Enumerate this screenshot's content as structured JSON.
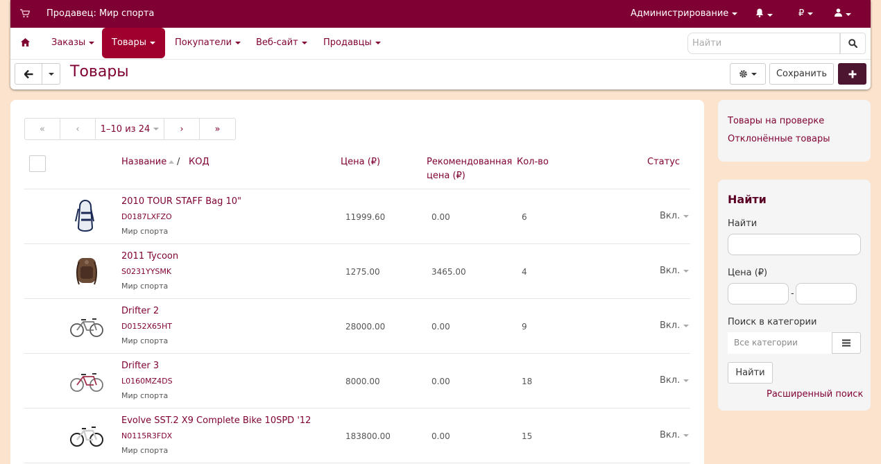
{
  "topbar": {
    "vendor_label": "Продавец: Мир спорта",
    "admin_label": "Администрирование",
    "currency_symbol": "₽"
  },
  "nav": {
    "items": [
      "Заказы",
      "Товары",
      "Покупатели",
      "Веб-сайт",
      "Продавцы"
    ],
    "active": "Товары",
    "search_placeholder": "Найти"
  },
  "toolbar": {
    "title": "Товары",
    "save_label": "Сохранить"
  },
  "pager": {
    "info": "1–10 из 24"
  },
  "table": {
    "headers": {
      "name": "Название",
      "sep": "/",
      "code": "КОД",
      "price": "Цена (₽)",
      "rec_price": "Рекомендованная цена (₽)",
      "qty": "Кол-во",
      "status": "Статус"
    },
    "rows": [
      {
        "name": "2010 TOUR STAFF Bag 10\"",
        "code": "D0187LXFZO",
        "vendor": "Мир спорта",
        "price": "11999.60",
        "rec": "0.00",
        "qty": "6",
        "status": "Вкл."
      },
      {
        "name": "2011 Tycoon",
        "code": "S0231YYSMK",
        "vendor": "Мир спорта",
        "price": "1275.00",
        "rec": "3465.00",
        "qty": "4",
        "status": "Вкл."
      },
      {
        "name": "Drifter 2",
        "code": "D0152X65HT",
        "vendor": "Мир спорта",
        "price": "28000.00",
        "rec": "0.00",
        "qty": "9",
        "status": "Вкл."
      },
      {
        "name": "Drifter 3",
        "code": "L0160MZ4DS",
        "vendor": "Мир спорта",
        "price": "8000.00",
        "rec": "0.00",
        "qty": "18",
        "status": "Вкл."
      },
      {
        "name": "Evolve SST.2 X9 Complete Bike 10SPD '12",
        "code": "N0115R3FDX",
        "vendor": "Мир спорта",
        "price": "183800.00",
        "rec": "0.00",
        "qty": "15",
        "status": "Вкл."
      }
    ]
  },
  "sidebar": {
    "links": [
      "Товары на проверке",
      "Отклонённые товары"
    ],
    "search": {
      "title": "Найти",
      "find_label": "Найти",
      "price_label": "Цена (₽)",
      "price_sep": "-",
      "category_label": "Поиск в категории",
      "category_value": "Все категории",
      "find_button": "Найти",
      "advanced_link": "Расширенный поиск"
    }
  },
  "colors": {
    "brand": "#7f0032",
    "active_tab": "#a0002e",
    "background": "#fbe3cd"
  }
}
